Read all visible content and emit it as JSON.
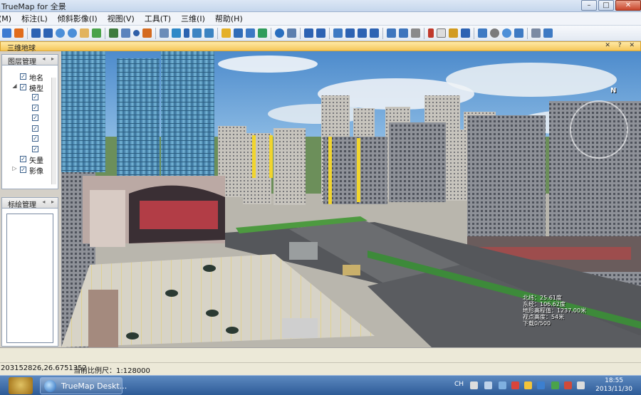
{
  "window": {
    "title": "TrueMap for 全景"
  },
  "window_controls": {
    "minimize": "–",
    "maximize": "□",
    "close": "✕"
  },
  "menu": [
    {
      "label": "(M)"
    },
    {
      "label": "标注(L)"
    },
    {
      "label": "倾斜影像(I)"
    },
    {
      "label": "视图(V)"
    },
    {
      "label": "工具(T)"
    },
    {
      "label": "三维(I)"
    },
    {
      "label": "帮助(H)"
    }
  ],
  "dock": {
    "title": "三维地球",
    "controls": "✕ ? ✕"
  },
  "layer_panel": {
    "title": "图层管理",
    "nav": "◂ ▸",
    "items": [
      {
        "label": "地名",
        "checked": "✓",
        "expand": ""
      },
      {
        "label": "模型",
        "checked": "✓",
        "expand": "◢"
      },
      {
        "label": "",
        "checked": "✓",
        "expand": ""
      },
      {
        "label": "",
        "checked": "✓",
        "expand": ""
      },
      {
        "label": "",
        "checked": "✓",
        "expand": ""
      },
      {
        "label": "",
        "checked": "✓",
        "expand": ""
      },
      {
        "label": "",
        "checked": "✓",
        "expand": ""
      },
      {
        "label": "",
        "checked": "✓",
        "expand": ""
      },
      {
        "label": "矢量",
        "checked": "✓",
        "expand": ""
      },
      {
        "label": "影像",
        "checked": "✓",
        "expand": "▷"
      }
    ]
  },
  "mark_panel": {
    "title": "标绘管理",
    "nav": "◂ ▸"
  },
  "view": {
    "compass_north": "N",
    "hud": [
      "北纬：25.61度",
      "东经：106.62度",
      "地形高程值：1237.00米",
      "视点高度：54米",
      "下载0/500"
    ]
  },
  "statusbar": {
    "coords": "203152826,26.6751352",
    "scale": "当前比例尺：1:128000"
  },
  "taskbar": {
    "app": "TrueMap Deskt...",
    "lang": "CH",
    "time": "18:55",
    "date": "2013/11/30"
  },
  "colors": {
    "accent": "#f5c75a",
    "sky": "#5f9ad2",
    "title_bg": "#c5d6ec"
  }
}
